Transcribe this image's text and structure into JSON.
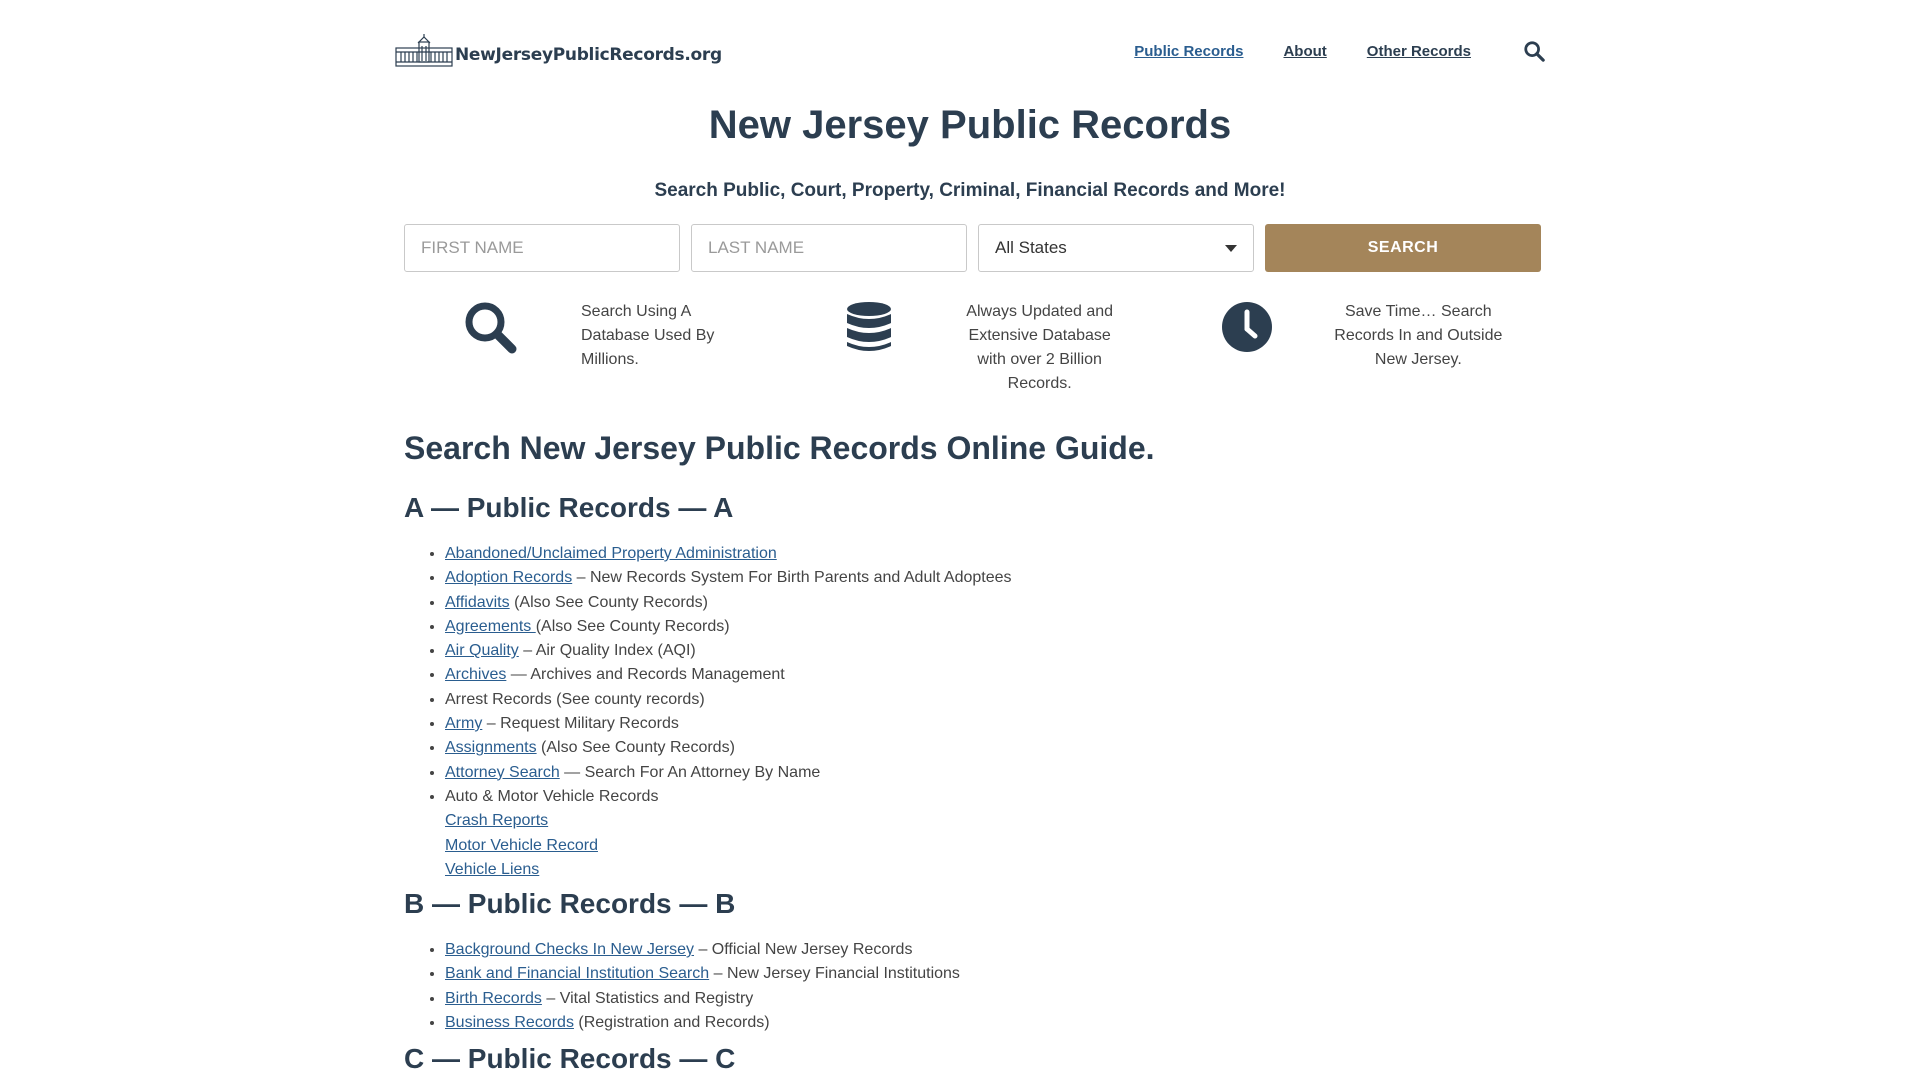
{
  "header": {
    "logo_text": "NewJerseyPublicRecords.org",
    "nav": [
      {
        "label": "Public Records"
      },
      {
        "label": "About"
      },
      {
        "label": "Other Records"
      }
    ]
  },
  "hero": {
    "title": "New Jersey Public Records",
    "subtitle": "Search Public, Court, Property, Criminal, Financial Records and More!"
  },
  "search": {
    "first_name_placeholder": "FIRST NAME",
    "last_name_placeholder": "LAST NAME",
    "state_value": "All States",
    "button_label": "SEARCH"
  },
  "features": [
    {
      "icon": "search-icon",
      "text": "Search Using A Database Used By Millions."
    },
    {
      "icon": "database-icon",
      "text": "Always Updated and Extensive Database with over 2 Billion Records."
    },
    {
      "icon": "clock-icon",
      "text": "Save Time… Search Records In and Outside New Jersey."
    }
  ],
  "guide": {
    "title": "Search New Jersey Public Records Online Guide.",
    "sections": [
      {
        "heading": "A — Public Records — A",
        "items": [
          {
            "link": "Abandoned/Unclaimed Property Administration",
            "rest": ""
          },
          {
            "link": "Adoption Records",
            "rest": " – New Records System For Birth Parents and Adult Adoptees"
          },
          {
            "link": "Affidavits",
            "rest": " (Also See County Records)"
          },
          {
            "link": "Agreements ",
            "rest": "(Also See County Records)"
          },
          {
            "link": "Air Quality",
            "rest": " – Air Quality Index (AQI)"
          },
          {
            "link": "Archives",
            "rest": " — Archives and Records Management"
          },
          {
            "link": "",
            "rest": "Arrest Records (See county records)"
          },
          {
            "link": "Army",
            "rest": " – Request Military Records"
          },
          {
            "link": "Assignments",
            "rest": " (Also See County Records)"
          },
          {
            "link": "Attorney Search",
            "rest": " — Search For An Attorney By Name"
          },
          {
            "link": "",
            "rest": "Auto & Motor Vehicle Records",
            "sub": [
              "Crash Reports",
              "Motor Vehicle Record",
              "Vehicle Liens"
            ]
          }
        ]
      },
      {
        "heading": "B — Public Records — B",
        "items": [
          {
            "link": "Background Checks In New Jersey",
            "rest": " – Official New Jersey Records"
          },
          {
            "link": "Bank and Financial Institution Search",
            "rest": " – New Jersey Financial Institutions"
          },
          {
            "link": "Birth Records",
            "rest": " – Vital Statistics and Registry"
          },
          {
            "link": "Business Records",
            "rest": " (Registration and Records)"
          }
        ]
      },
      {
        "heading": "C — Public Records — C",
        "items": []
      }
    ]
  }
}
